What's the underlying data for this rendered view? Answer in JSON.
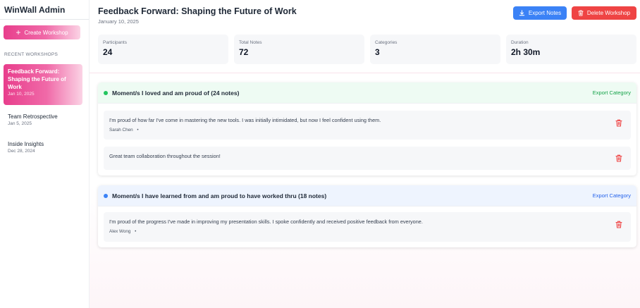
{
  "app": {
    "title": "WinWall Admin"
  },
  "sidebar": {
    "create_label": "Create Workshop",
    "section_label": "RECENT WORKSHOPS",
    "workshops": [
      {
        "title": "Feedback Forward: Shaping the Future of Work",
        "date": "Jan 10, 2025"
      },
      {
        "title": "Team Retrospective",
        "date": "Jan 5, 2025"
      },
      {
        "title": "Inside Insights",
        "date": "Dec 28, 2024"
      }
    ]
  },
  "header": {
    "title": "Feedback Forward: Shaping the Future of Work",
    "date": "January 10, 2025",
    "export_label": "Export Notes",
    "delete_label": "Delete Workshop"
  },
  "stats": [
    {
      "label": "Participants",
      "value": "24"
    },
    {
      "label": "Total Notes",
      "value": "72"
    },
    {
      "label": "Categories",
      "value": "3"
    },
    {
      "label": "Duration",
      "value": "2h 30m"
    }
  ],
  "categories": [
    {
      "title": "Moment/s I loved and am proud of (24 notes)",
      "export_label": "Export Category",
      "color": "#22c55e",
      "notes": [
        {
          "text": "I'm proud of how far I've come in mastering the new tools. I was initially intimidated, but now I feel confident using them.",
          "author": "Sarah Chen",
          "sep": "•"
        },
        {
          "text": "Great team collaboration throughout the session!"
        }
      ]
    },
    {
      "title": "Moment/s I have learned from and am proud to have worked thru (18 notes)",
      "export_label": "Export Category",
      "color": "#3b82f6",
      "notes": [
        {
          "text": "I'm proud of the progress I've made in improving my presentation skills. I spoke confidently and received positive feedback from everyone.",
          "author": "Alex Wong",
          "sep": "•"
        }
      ]
    }
  ],
  "colors": {
    "brand_pink": "#e83e8c",
    "primary_blue": "#3b82f6",
    "danger_red": "#ef4444"
  },
  "icons": {
    "create": "plus-icon",
    "export": "download-icon",
    "delete": "trash-icon"
  }
}
